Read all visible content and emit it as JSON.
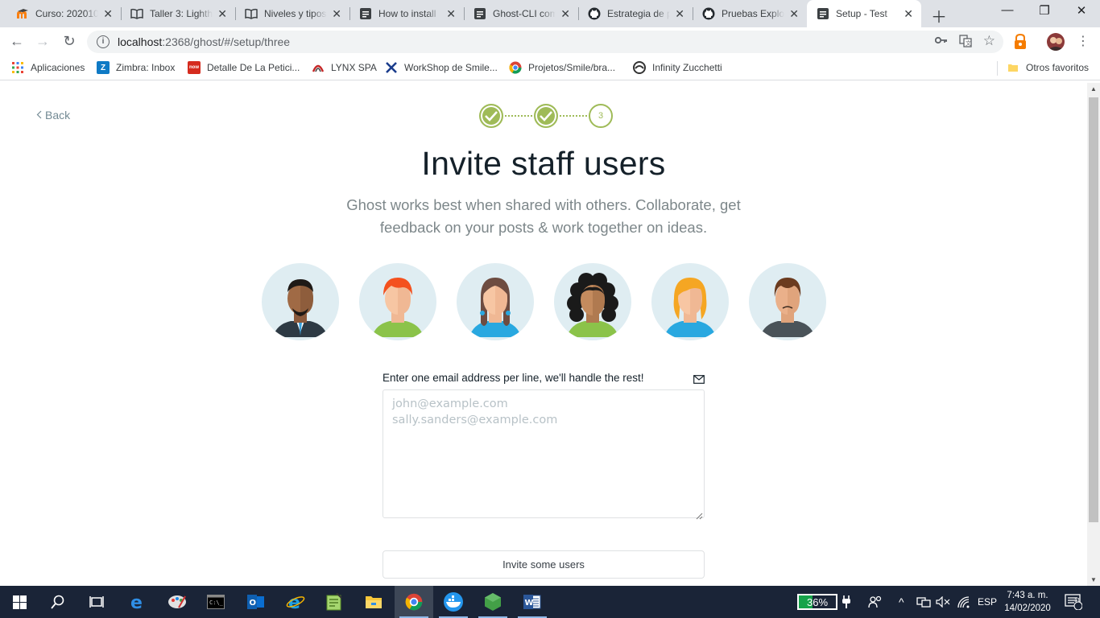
{
  "browser": {
    "tabs": [
      {
        "title": "Curso: 202010",
        "icon": "moodle-icon"
      },
      {
        "title": "Taller 3: Lighth",
        "icon": "book-icon"
      },
      {
        "title": "Niveles y tipos",
        "icon": "book-icon"
      },
      {
        "title": "How to install",
        "icon": "ghost-doc-icon"
      },
      {
        "title": "Ghost-CLI com",
        "icon": "ghost-doc-icon"
      },
      {
        "title": "Estrategia de p",
        "icon": "github-icon"
      },
      {
        "title": "Pruebas Explor",
        "icon": "github-icon"
      },
      {
        "title": "Setup - Test",
        "icon": "ghost-doc-icon",
        "active": true
      }
    ],
    "url_host": "localhost",
    "url_path": ":2368/ghost/#/setup/three",
    "bookmarks": [
      {
        "label": "Aplicaciones",
        "icon": "apps-grid-icon"
      },
      {
        "label": "Zimbra: Inbox",
        "icon": "zimbra-icon"
      },
      {
        "label": "Detalle De La Petici...",
        "icon": "now-icon",
        "badge": "now"
      },
      {
        "label": "LYNX SPA",
        "icon": "lynx-icon"
      },
      {
        "label": "WorkShop de Smile...",
        "icon": "workshop-icon"
      },
      {
        "label": "Projetos/Smile/bra...",
        "icon": "chrome-icon"
      },
      {
        "label": "Infinity Zucchetti",
        "icon": "infinity-icon"
      }
    ],
    "other_bookmarks": "Otros favoritos"
  },
  "setup": {
    "back_label": "Back",
    "current_step": "3",
    "title": "Invite staff users",
    "subtitle": "Ghost works best when shared with others. Collaborate, get feedback on your posts & work together on ideas.",
    "email_label": "Enter one email address per line, we'll handle the rest!",
    "email_placeholder_1": "john@example.com",
    "email_placeholder_2": "sally.sanders@example.com",
    "email_placeholder": "john@example.com\nsally.sanders@example.com",
    "invite_button": "Invite some users",
    "accent_color": "#9fbb58"
  },
  "taskbar": {
    "battery": "36%",
    "language": "ESP",
    "time": "7:43 a. m.",
    "date": "14/02/2020",
    "notifications": "11"
  }
}
